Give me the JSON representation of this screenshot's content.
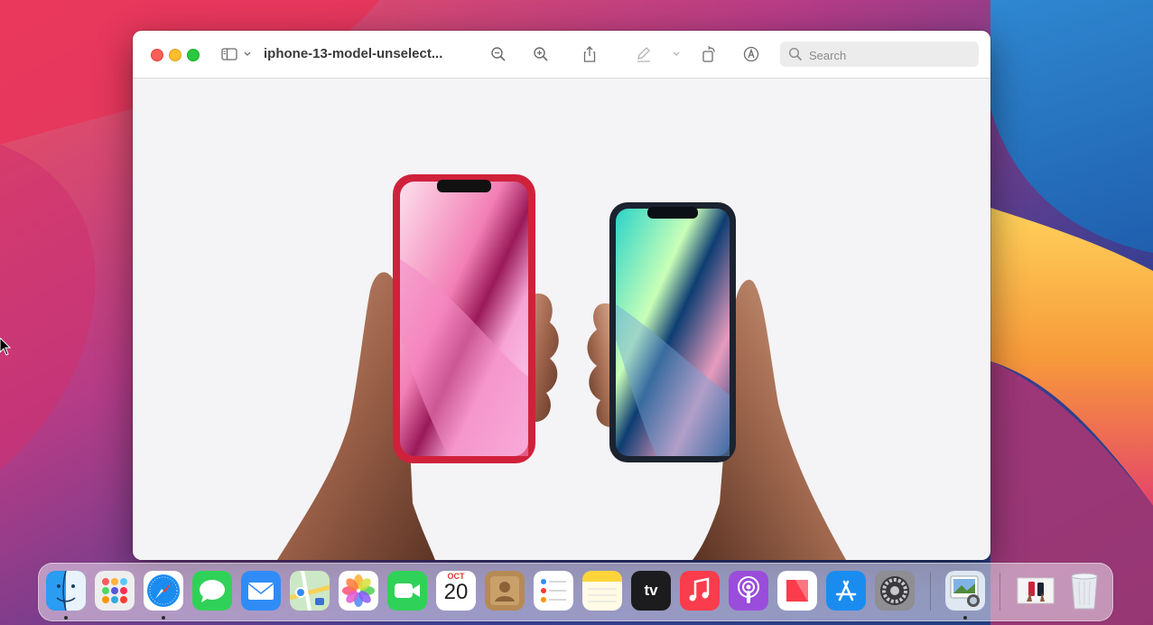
{
  "window": {
    "title": "iphone-13-model-unselect...",
    "search_placeholder": "Search"
  },
  "toolbar": {
    "icons": [
      "sidebar-icon",
      "zoom-out-icon",
      "zoom-in-icon",
      "share-icon",
      "markup-pen-icon",
      "rotate-icon",
      "annotate-icon"
    ]
  },
  "dock": {
    "calendar": {
      "month": "OCT",
      "day": "20"
    },
    "tv_label": "tv",
    "apps": [
      "Finder",
      "Launchpad",
      "Safari",
      "Messages",
      "Mail",
      "Maps",
      "Photos",
      "FaceTime",
      "Calendar",
      "Contacts",
      "Reminders",
      "Notes",
      "TV",
      "Music",
      "Podcasts",
      "News",
      "App Store",
      "System Preferences",
      "Preview",
      "Preview Document",
      "Trash"
    ]
  },
  "colors": {
    "accent_red": "#ff5f57",
    "accent_yellow": "#febc2e",
    "accent_green": "#28c840",
    "phone_pink_frame": "#d0213b",
    "phone_dark_frame": "#1c2330"
  }
}
